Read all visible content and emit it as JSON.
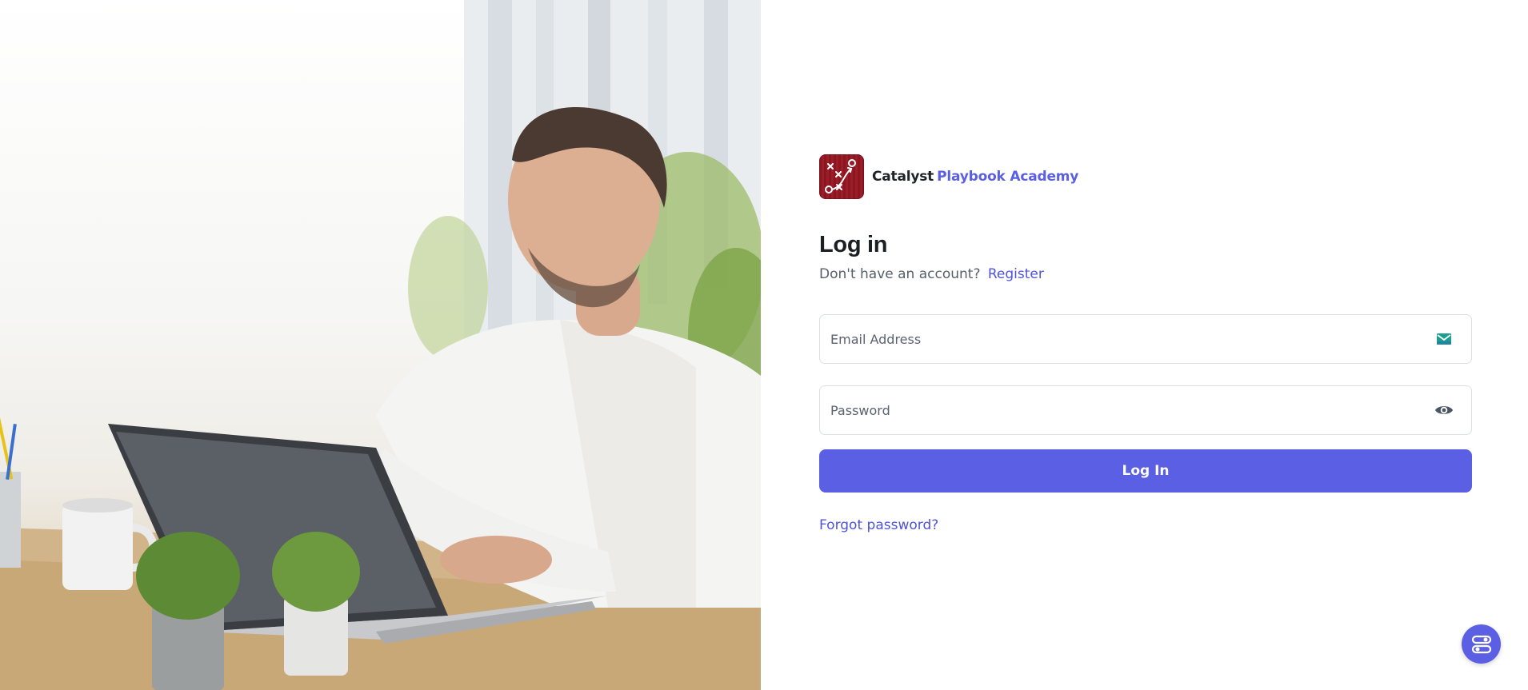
{
  "brand": {
    "name_part1": "Catalyst",
    "name_part2": "Playbook Academy"
  },
  "login": {
    "title": "Log in",
    "no_account_text": "Don't have an account?",
    "register_link": "Register",
    "email_placeholder": "Email Address",
    "password_placeholder": "Password",
    "submit_label": "Log In",
    "forgot_link": "Forgot password?"
  },
  "icons": {
    "email": "email-icon",
    "password_toggle": "eye-icon",
    "fab": "toggle-settings-icon",
    "logo": "playbook-logo-icon"
  },
  "colors": {
    "accent": "#5b5fe3",
    "link": "#4f53d9",
    "logo_bg": "#8a1621",
    "email_icon": "#1a9e8f"
  },
  "hero_image": {
    "alt": "man working on laptop"
  }
}
